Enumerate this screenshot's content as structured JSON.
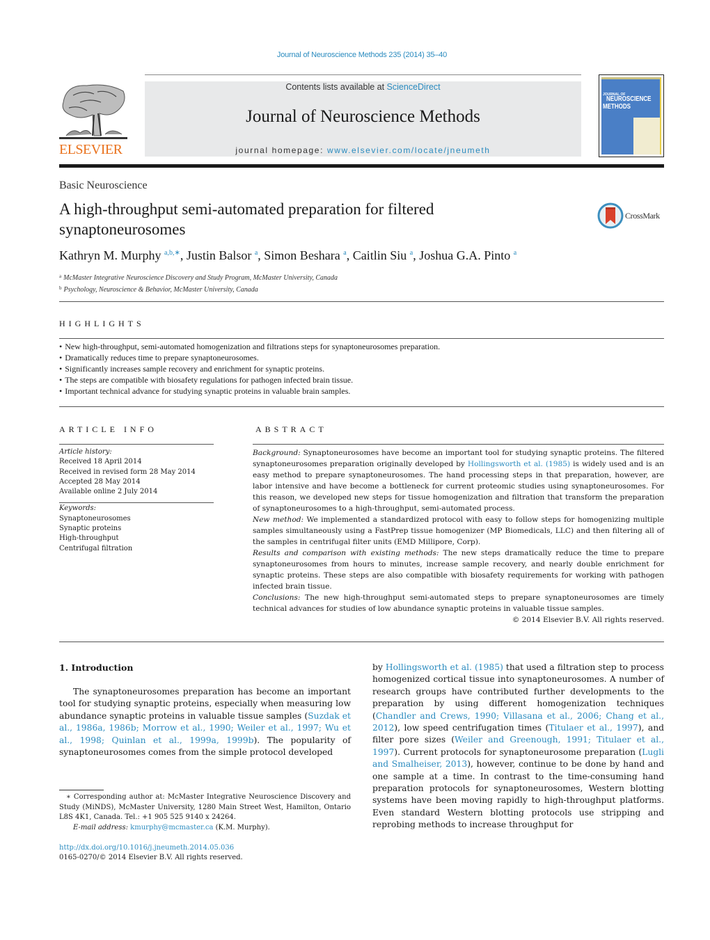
{
  "header": {
    "citation": "Journal of Neuroscience Methods 235 (2014) 35–40",
    "contents_prefix": "Contents lists available at ",
    "contents_link": "ScienceDirect",
    "journal_title": "Journal of Neuroscience Methods",
    "homepage_prefix": "journal homepage: ",
    "homepage_link": "www.elsevier.com/locate/jneumeth",
    "publisher_logo_text": "ELSEVIER",
    "cover": {
      "line1": "JOURNAL OF",
      "line2": "NEUROSCIENCE",
      "line3": "METHODS"
    },
    "colors": {
      "link": "#2a8bbf",
      "elsevier_orange": "#e9711c",
      "cover_blue": "#4a7fc6"
    }
  },
  "article": {
    "section": "Basic Neuroscience",
    "title": "A high-throughput semi-automated preparation for filtered synaptoneurosomes",
    "crossmark_label": "CrossMark",
    "authors": [
      {
        "name": "Kathryn M. Murphy",
        "sup": "a,b,∗",
        "sep": ", "
      },
      {
        "name": "Justin Balsor",
        "sup": "a",
        "sep": ", "
      },
      {
        "name": "Simon Beshara",
        "sup": "a",
        "sep": ", "
      },
      {
        "name": "Caitlin Siu",
        "sup": "a",
        "sep": ", "
      },
      {
        "name": "Joshua G.A. Pinto",
        "sup": "a",
        "sep": ""
      }
    ],
    "affiliations": [
      {
        "key": "a",
        "text": "McMaster Integrative Neuroscience Discovery and Study Program, McMaster University, Canada"
      },
      {
        "key": "b",
        "text": "Psychology, Neuroscience & Behavior, McMaster University, Canada"
      }
    ]
  },
  "highlights": {
    "heading": "HIGHLIGHTS",
    "items": [
      "New high-throughput, semi-automated homogenization and filtrations steps for synaptoneurosomes preparation.",
      "Dramatically reduces time to prepare synaptoneurosomes.",
      "Significantly increases sample recovery and enrichment for synaptic proteins.",
      "The steps are compatible with biosafety regulations for pathogen infected brain tissue.",
      "Important technical advance for studying synaptic proteins in valuable brain samples."
    ]
  },
  "article_info": {
    "heading": "ARTICLE INFO",
    "history_label": "Article history:",
    "history": [
      "Received 18 April 2014",
      "Received in revised form 28 May 2014",
      "Accepted 28 May 2014",
      "Available online 2 July 2014"
    ],
    "keywords_label": "Keywords:",
    "keywords": [
      "Synaptoneurosomes",
      "Synaptic proteins",
      "High-throughput",
      "Centrifugal filtration"
    ]
  },
  "abstract": {
    "heading": "ABSTRACT",
    "background_label": "Background:",
    "background_1": " Synaptoneurosomes have become an important tool for studying synaptic proteins. The filtered synaptoneurosomes preparation originally developed by ",
    "background_link": "Hollingsworth et al. (1985)",
    "background_2": " is widely used and is an easy method to prepare synaptoneurosomes. The hand processing steps in that preparation, however, are labor intensive and have become a bottleneck for current proteomic studies using synaptoneurosomes. For this reason, we developed new steps for tissue homogenization and filtration that transform the preparation of synaptoneurosomes to a high-throughput, semi-automated process.",
    "new_method_label": "New method:",
    "new_method": " We implemented a standardized protocol with easy to follow steps for homogenizing multiple samples simultaneously using a FastPrep tissue homogenizer (MP Biomedicals, LLC) and then filtering all of the samples in centrifugal filter units (EMD Millipore, Corp).",
    "results_label": "Results and comparison with existing methods:",
    "results": " The new steps dramatically reduce the time to prepare synaptoneurosomes from hours to minutes, increase sample recovery, and nearly double enrichment for synaptic proteins. These steps are also compatible with biosafety requirements for working with pathogen infected brain tissue.",
    "conclusions_label": "Conclusions:",
    "conclusions": " The new high-throughput semi-automated steps to prepare synaptoneurosomes are timely technical advances for studies of low abundance synaptic proteins in valuable tissue samples.",
    "copyright": "© 2014 Elsevier B.V. All rights reserved."
  },
  "intro": {
    "heading": "1.  Introduction",
    "left_1": "The synaptoneurosomes preparation has become an important tool for studying synaptic proteins, especially when measuring low abundance synaptic proteins in valuable tissue samples (",
    "left_link_1": "Suzdak et al., 1986a, 1986b; Morrow et al., 1990; Weiler et al., 1997; Wu et al., 1998; Quinlan et al., 1999a, 1999b",
    "left_2": "). The popularity of synaptoneurosomes comes from the simple protocol developed",
    "right_1": "by ",
    "right_link_1": "Hollingsworth et al. (1985)",
    "right_2": " that used a filtration step to process homogenized cortical tissue into synaptoneurosomes. A number of research groups have contributed further developments to the preparation by using different homogenization techniques (",
    "right_link_2": "Chandler and Crews, 1990; Villasana et al., 2006; Chang et al., 2012",
    "right_3": "), low speed centrifugation times (",
    "right_link_3": "Titulaer et al., 1997",
    "right_4": "), and filter pore sizes (",
    "right_link_4": "Weiler and Greenough, 1991; Titulaer et al., 1997",
    "right_5": "). Current protocols for synaptoneurosome preparation (",
    "right_link_5": "Lugli and Smalheiser, 2013",
    "right_6": "), however, continue to be done by hand and one sample at a time. In contrast to the time-consuming hand preparation protocols for synaptoneurosomes, Western blotting systems have been moving rapidly to high-throughput platforms. Even standard Western blotting protocols use stripping and reprobing methods to increase throughput for"
  },
  "footnotes": {
    "corresponding": "∗ Corresponding author at: McMaster Integrative Neuroscience Discovery and Study (MiNDS), McMaster University, 1280 Main Street West, Hamilton, Ontario L8S 4K1, Canada. Tel.: +1 905 525 9140 x 24264.",
    "email_label": "E-mail address:",
    "email": "kmurphy@mcmaster.ca",
    "email_suffix": " (K.M. Murphy).",
    "doi": "http://dx.doi.org/10.1016/j.jneumeth.2014.05.036",
    "issn": "0165-0270/© 2014 Elsevier B.V. All rights reserved."
  }
}
